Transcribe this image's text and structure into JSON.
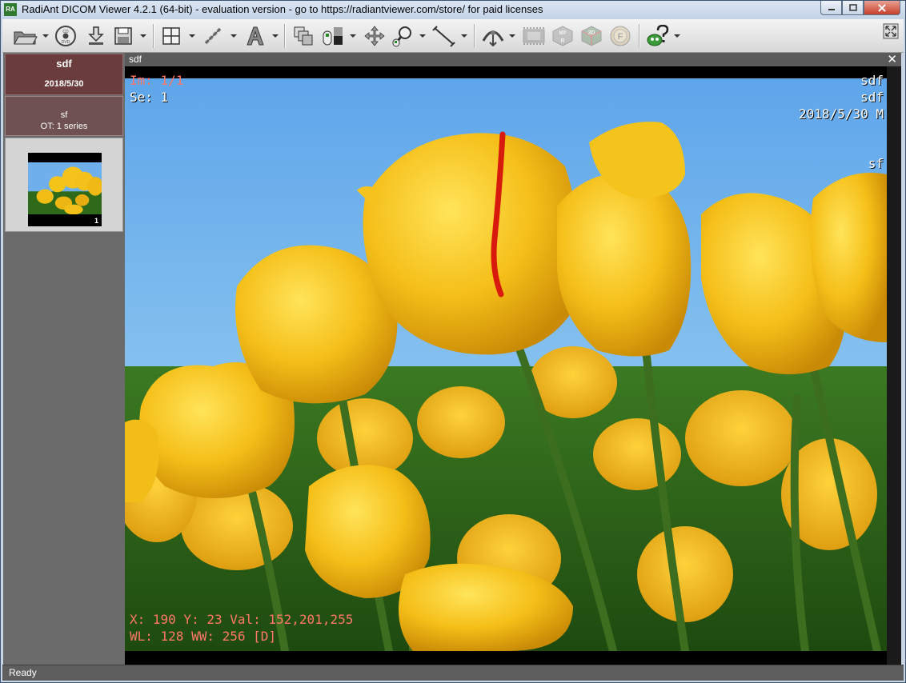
{
  "window": {
    "title": "RadiAnt DICOM Viewer 4.2.1 (64-bit) - evaluation version - go to https://radiantviewer.com/store/ for paid licenses",
    "icon_text": "RA",
    "controls": [
      "minimize",
      "maximize",
      "close"
    ]
  },
  "toolbar": {
    "icons": [
      "open-folder-icon",
      "cd-dvd-icon",
      "download-icon",
      "save-icon",
      "layout-grid-icon",
      "sync-link-icon",
      "annotation-text-icon",
      "stack-series-icon",
      "mouse-window-level-icon",
      "pan-icon",
      "zoom-icon",
      "measure-line-icon",
      "3d-mpr-icon",
      "cine-film-icon",
      "mpr-icon",
      "3d-volume-icon",
      "fusion-icon",
      "help-icon",
      "fullscreen-icon"
    ],
    "cd_label": "CD DVD",
    "mpr_label": "MPR",
    "vr_label": "3D",
    "fusion_label": "F"
  },
  "study": {
    "name": "sdf",
    "date": "2018/5/30"
  },
  "series": {
    "name": "sf",
    "desc": "OT: 1 series",
    "thumb_number": "1"
  },
  "viewer": {
    "tab_title": "sdf",
    "overlay_top_left": {
      "image": "Im: 1/1",
      "series": "Se: 1"
    },
    "overlay_top_right": {
      "line1": "sdf",
      "line2": "sdf",
      "line3": "2018/5/30 M",
      "line4": "sf"
    },
    "overlay_bottom_left": {
      "pixel": "X: 190 Y: 23 Val: 152,201,255",
      "window": "WL: 128 WW: 256 [D]"
    }
  },
  "status": {
    "text": "Ready"
  },
  "colors": {
    "study_bg": "#6a3c3c",
    "overlay_red": "#ff7766",
    "sky": "#6fb0ec",
    "petal": "#f2be16"
  }
}
